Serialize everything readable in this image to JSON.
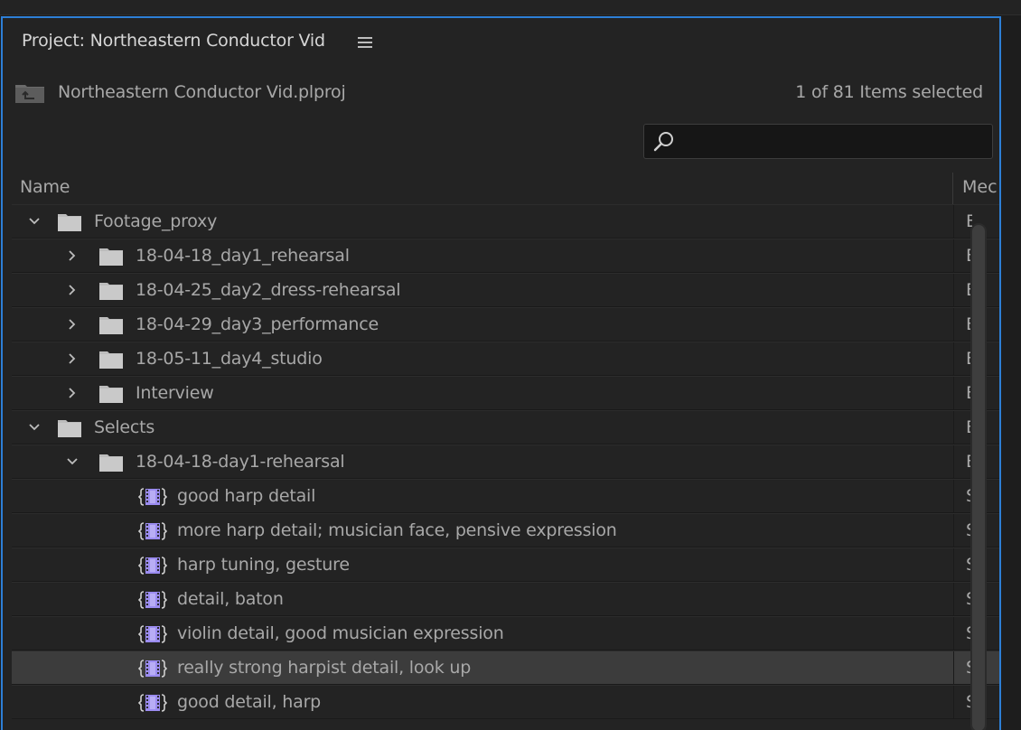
{
  "panel": {
    "title": "Project: Northeastern Conductor Vid",
    "project_file": "Northeastern Conductor Vid.plproj",
    "items_selected": "1 of 81 Items selected"
  },
  "search": {
    "value": "",
    "placeholder": ""
  },
  "columns": {
    "name": "Name",
    "media": "Mec"
  },
  "rows": [
    {
      "label": "Footage_proxy",
      "type": "folder",
      "depth": 0,
      "expanded": true,
      "media": "E",
      "selected": false
    },
    {
      "label": "18-04-18_day1_rehearsal",
      "type": "folder",
      "depth": 1,
      "expanded": false,
      "media": "E",
      "selected": false
    },
    {
      "label": "18-04-25_day2_dress-rehearsal",
      "type": "folder",
      "depth": 1,
      "expanded": false,
      "media": "E",
      "selected": false
    },
    {
      "label": "18-04-29_day3_performance",
      "type": "folder",
      "depth": 1,
      "expanded": false,
      "media": "E",
      "selected": false
    },
    {
      "label": "18-05-11_day4_studio",
      "type": "folder",
      "depth": 1,
      "expanded": false,
      "media": "E",
      "selected": false
    },
    {
      "label": "Interview",
      "type": "folder",
      "depth": 1,
      "expanded": false,
      "media": "E",
      "selected": false
    },
    {
      "label": "Selects",
      "type": "folder",
      "depth": 0,
      "expanded": true,
      "media": "E",
      "selected": false
    },
    {
      "label": "18-04-18-day1-rehearsal",
      "type": "folder",
      "depth": 1,
      "expanded": true,
      "media": "E",
      "selected": false
    },
    {
      "label": "good harp detail",
      "type": "sequence",
      "depth": 2,
      "media": "S",
      "selected": false
    },
    {
      "label": "more harp detail; musician face, pensive expression",
      "type": "sequence",
      "depth": 2,
      "media": "S",
      "selected": false
    },
    {
      "label": "harp tuning, gesture",
      "type": "sequence",
      "depth": 2,
      "media": "S",
      "selected": false
    },
    {
      "label": "detail, baton",
      "type": "sequence",
      "depth": 2,
      "media": "S",
      "selected": false
    },
    {
      "label": "violin detail, good musician expression",
      "type": "sequence",
      "depth": 2,
      "media": "S",
      "selected": false
    },
    {
      "label": "really strong harpist detail, look up",
      "type": "sequence",
      "depth": 2,
      "media": "S",
      "selected": true
    },
    {
      "label": "good detail, harp",
      "type": "sequence",
      "depth": 2,
      "media": "S",
      "selected": false
    }
  ],
  "icons": {
    "panel_menu": "hamburger-menu-icon",
    "project": "project-folder-icon",
    "search": "search-icon",
    "folder": "folder-icon",
    "sequence": "sequence-icon",
    "expanded": "chevron-down-icon",
    "collapsed": "chevron-right-icon"
  },
  "colors": {
    "panel_focus_border": "#2d7fd6",
    "sequence_icon": "#9b8cf0",
    "selected_row": "#3c3c3c",
    "background": "#232323"
  }
}
